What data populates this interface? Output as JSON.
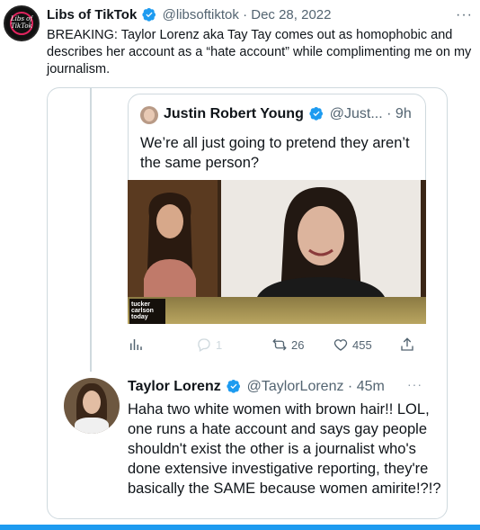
{
  "tweet": {
    "name": "Libs of TikTok",
    "handle": "@libsoftiktok",
    "separator": "·",
    "date": "Dec 28, 2022",
    "more": "···",
    "avatar_text": "Libs of TikTok",
    "body": "BREAKING: Taylor Lorenz aka Tay Tay comes out as homophobic and describes her account as a “hate account” while complimenting me on my journalism."
  },
  "quoted": {
    "name": "Justin Robert Young",
    "handle": "@Just...",
    "separator": "·",
    "time": "9h",
    "text": "We’re all just going to pretend they aren’t the same person?",
    "media_logo": "tucker carlson today",
    "actions": {
      "replies": "1",
      "retweets": "26",
      "likes": "455"
    }
  },
  "reply": {
    "name": "Taylor Lorenz",
    "handle": "@TaylorLorenz",
    "separator": "·",
    "time": "45m",
    "more": "···",
    "text": "Haha two white women with brown hair!! LOL, one runs a hate account and says gay people shouldn't exist the other is a journalist who's done extensive investigative reporting, they're basically the SAME because women amirite!?!?"
  },
  "colors": {
    "verified": "#1d9bf0",
    "secondary_text": "#536471",
    "border": "#cfd9de",
    "accent_bar": "#1d9bf0"
  }
}
